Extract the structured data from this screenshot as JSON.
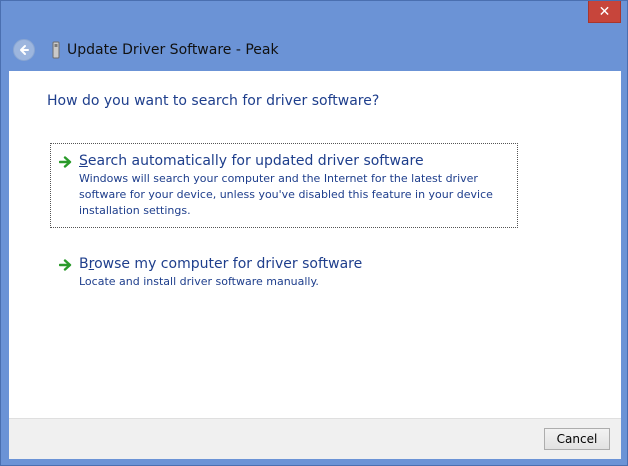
{
  "window": {
    "title": "Update Driver Software - Peak",
    "close_glyph": "✕"
  },
  "main": {
    "heading": "How do you want to search for driver software?",
    "options": [
      {
        "title_prefix": "",
        "title_accel": "S",
        "title_rest": "earch automatically for updated driver software",
        "description": "Windows will search your computer and the Internet for the latest driver software for your device, unless you've disabled this feature in your device installation settings.",
        "icon": "green-arrow-icon"
      },
      {
        "title_prefix": "B",
        "title_accel": "r",
        "title_rest": "owse my computer for driver software",
        "description": "Locate and install driver software manually.",
        "icon": "green-arrow-icon"
      }
    ]
  },
  "footer": {
    "cancel_label": "Cancel"
  },
  "colors": {
    "frame": "#6b93d6",
    "link_text": "#1e3e8c",
    "close_button": "#c7453b",
    "arrow": "#2a9a2a"
  }
}
